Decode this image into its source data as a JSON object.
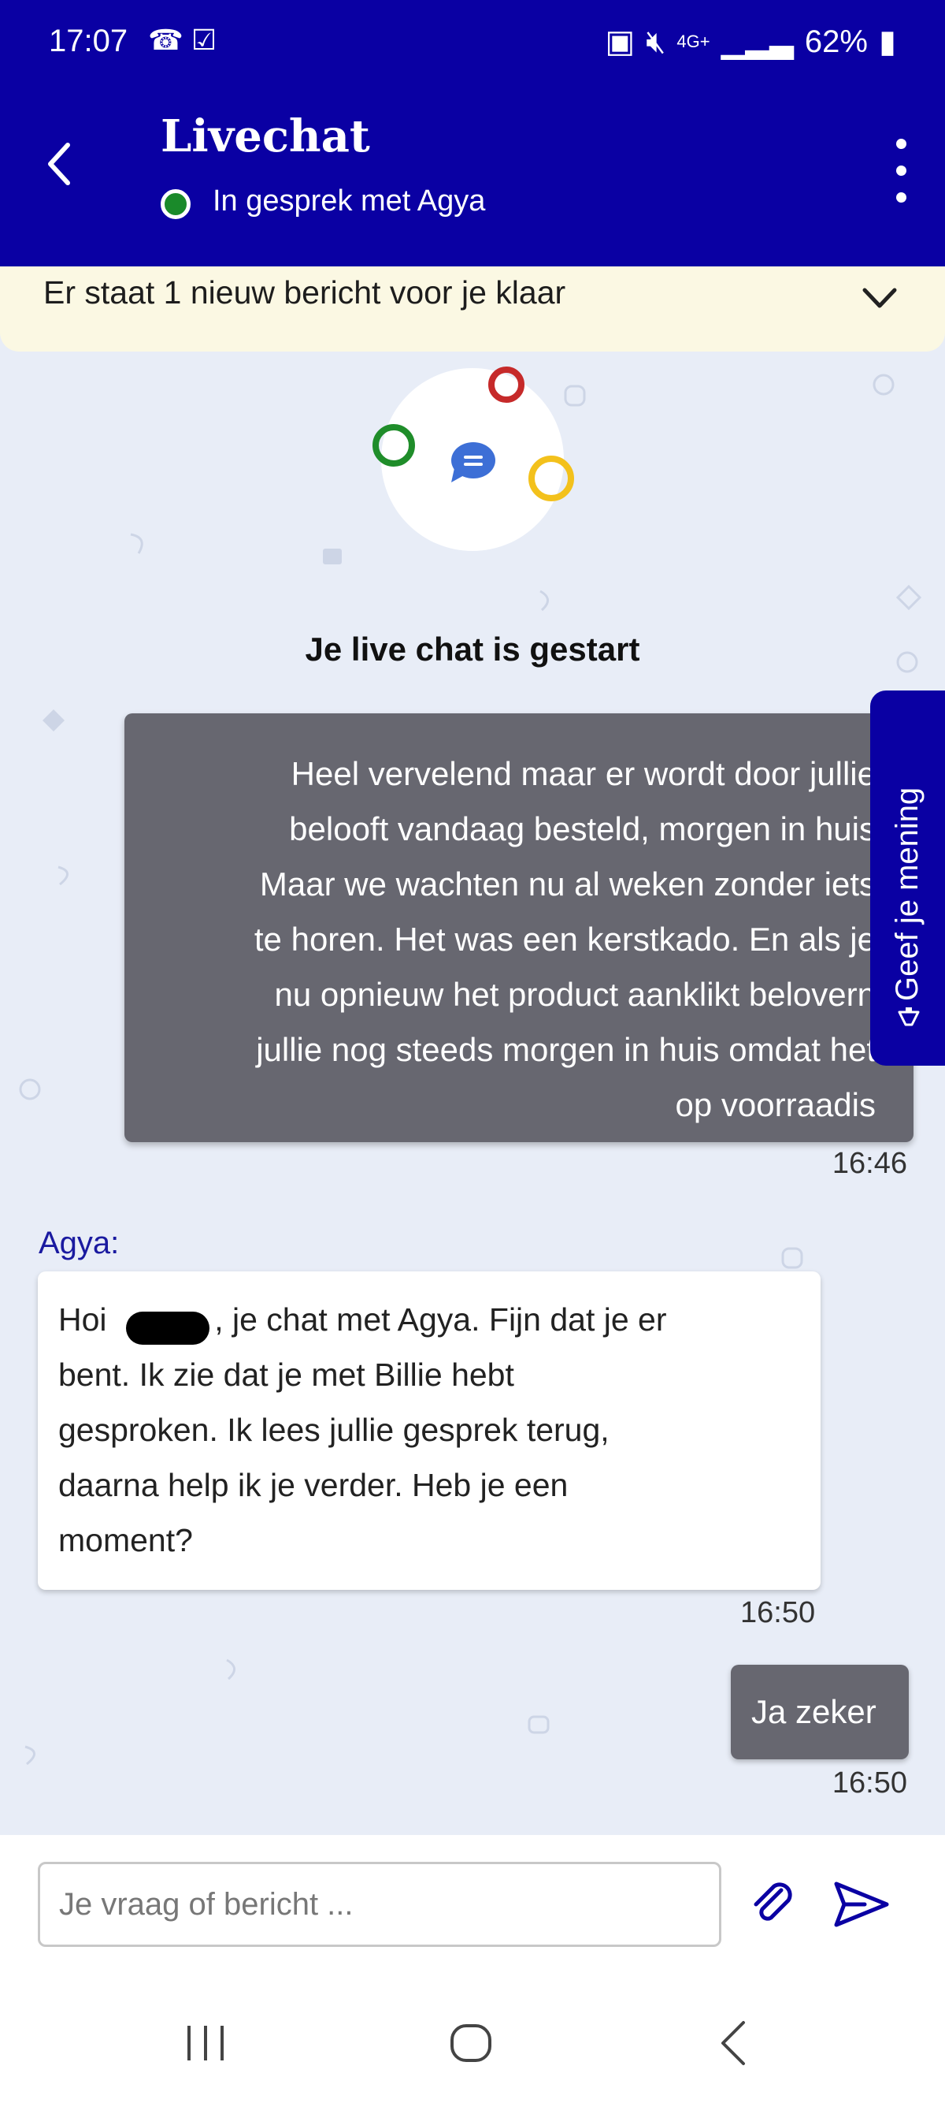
{
  "status_bar": {
    "time": "17:07",
    "left_icons": [
      "missed-call-icon",
      "check-box-icon"
    ],
    "network": "4G+",
    "battery": "62%",
    "right_icons": [
      "battery-saver-icon",
      "mute-icon",
      "signal-icon",
      "battery-icon"
    ]
  },
  "header": {
    "title": "Livechat",
    "subtitle": "In gesprek met Agya",
    "status_color": "#1a8a2a",
    "background_color": "#0a00a3"
  },
  "banner": {
    "text": "Er staat 1 nieuw bericht voor je klaar"
  },
  "chat": {
    "started_title": "Je live chat is gestart",
    "messages": [
      {
        "sender": "user",
        "lines": [
          "Heel vervelend maar er wordt door jullie",
          "belooft vandaag besteld, morgen in huis",
          "Maar we wachten nu al weken zonder iets",
          "te horen. Het was een kerstkado. En als je",
          "nu opnieuw het product aanklikt belovern",
          "jullie nog steeds morgen in huis omdat het",
          "op voorraadis"
        ],
        "time": "16:46"
      },
      {
        "sender": "agent",
        "name_label": "Agya:",
        "lines": [
          "Hoi            , je chat met Agya. Fijn dat je er",
          "bent. Ik zie dat je met Billie hebt",
          "gesproken. Ik lees jullie gesprek terug,",
          "daarna help ik je verder. Heb je een",
          "moment?"
        ],
        "time": "16:50"
      },
      {
        "sender": "user",
        "lines": [
          "Ja zeker"
        ],
        "time": "16:50"
      }
    ]
  },
  "feedback_tab": {
    "label": "Geef je mening"
  },
  "composer": {
    "placeholder": "Je vraag of bericht ...",
    "value": ""
  },
  "nav": {
    "items": [
      "recents-icon",
      "home-icon",
      "back-icon"
    ]
  },
  "colors": {
    "brand": "#0a00a3",
    "user_bubble": "#676770",
    "chat_background": "#e8edf7",
    "banner_background": "#fbf8e3",
    "agent_name": "#1a1aa0"
  }
}
